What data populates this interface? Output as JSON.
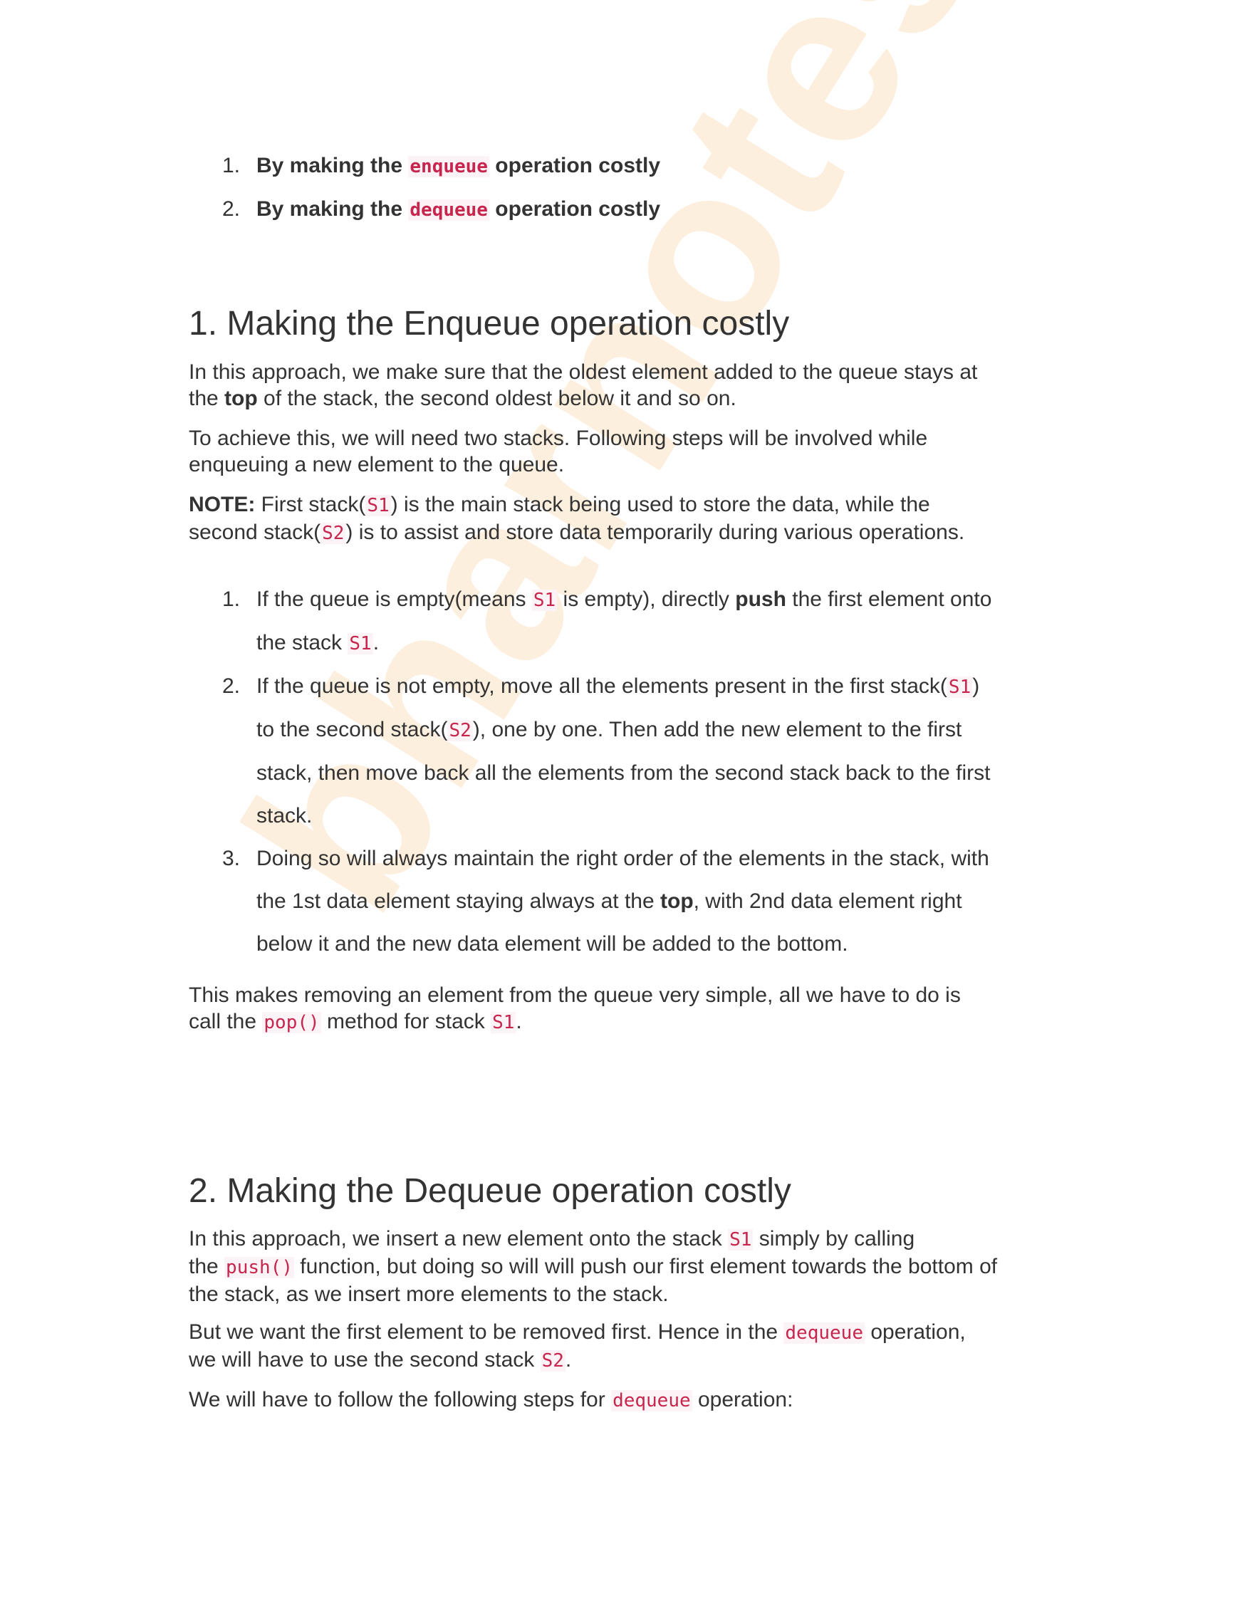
{
  "watermark": "bharnotes",
  "colors": {
    "text": "#333333",
    "code": "#c7254e",
    "watermark": "#f7a23a"
  },
  "intro_list": [
    {
      "num": "1.",
      "lines": [
        [
          {
            "t": "By making the "
          },
          {
            "t": "enqueue",
            "s": "code"
          },
          {
            "t": " operation costly"
          }
        ]
      ]
    },
    {
      "num": "2.",
      "lines": [
        [
          {
            "t": "By making the "
          },
          {
            "t": "dequeue",
            "s": "code"
          },
          {
            "t": " operation costly"
          }
        ]
      ]
    }
  ],
  "section1": {
    "heading": "1. Making the Enqueue operation costly",
    "p1": [
      [
        {
          "t": "In this approach, we make sure that the oldest element added to the queue stays at"
        }
      ],
      [
        {
          "t": "the "
        },
        {
          "t": "top",
          "s": "b"
        },
        {
          "t": " of the stack, the second oldest below it and so on."
        }
      ]
    ],
    "p2": [
      [
        {
          "t": "To achieve this, we will need two stacks. Following steps will be involved while"
        }
      ],
      [
        {
          "t": "enqueuing a new element to the queue."
        }
      ]
    ],
    "p3": [
      [
        {
          "t": "NOTE:",
          "s": "b"
        },
        {
          "t": " First stack("
        },
        {
          "t": "S1",
          "s": "code"
        },
        {
          "t": ") is the main stack being used to store the data, while the"
        }
      ],
      [
        {
          "t": "second stack("
        },
        {
          "t": "S2",
          "s": "code"
        },
        {
          "t": ") is to assist and store data temporarily during various operations."
        }
      ]
    ],
    "steps": [
      {
        "num": "1.",
        "lines": [
          [
            {
              "t": "If the queue is empty(means "
            },
            {
              "t": "S1",
              "s": "code"
            },
            {
              "t": " is empty), directly "
            },
            {
              "t": "push",
              "s": "b"
            },
            {
              "t": " the first element onto"
            }
          ],
          [
            {
              "t": "the stack "
            },
            {
              "t": "S1",
              "s": "code"
            },
            {
              "t": "."
            }
          ]
        ]
      },
      {
        "num": "2.",
        "lines": [
          [
            {
              "t": "If the queue is not empty, move all the elements present in the first stack("
            },
            {
              "t": "S1",
              "s": "code"
            },
            {
              "t": ")"
            }
          ],
          [
            {
              "t": "to the second stack("
            },
            {
              "t": "S2",
              "s": "code"
            },
            {
              "t": "), one by one. Then add the new element to the first"
            }
          ],
          [
            {
              "t": "stack, then move back all the elements from the second stack back to the first"
            }
          ],
          [
            {
              "t": "stack."
            }
          ]
        ]
      },
      {
        "num": "3.",
        "lines": [
          [
            {
              "t": "Doing so will always maintain the right order of the elements in the stack, with"
            }
          ],
          [
            {
              "t": "the 1st data element staying always at the "
            },
            {
              "t": "top",
              "s": "b"
            },
            {
              "t": ", with 2nd data element right"
            }
          ],
          [
            {
              "t": "below it and the new data element will be added to the bottom."
            }
          ]
        ]
      }
    ],
    "p4": [
      [
        {
          "t": "This makes removing an element from the queue very simple, all we have to do is"
        }
      ],
      [
        {
          "t": "call the "
        },
        {
          "t": "pop()",
          "s": "code"
        },
        {
          "t": " method for stack "
        },
        {
          "t": "S1",
          "s": "code"
        },
        {
          "t": "."
        }
      ]
    ]
  },
  "section2": {
    "heading": "2. Making the Dequeue operation costly",
    "p1": [
      [
        {
          "t": "In this approach, we insert a new element onto the stack "
        },
        {
          "t": "S1",
          "s": "code"
        },
        {
          "t": " simply by calling"
        }
      ],
      [
        {
          "t": "the "
        },
        {
          "t": "push()",
          "s": "code"
        },
        {
          "t": " function, but doing so will will push our first element towards the bottom of"
        }
      ],
      [
        {
          "t": "the stack, as we insert more elements to the stack."
        }
      ]
    ],
    "p2": [
      [
        {
          "t": "But we want the first element to be removed first. Hence in the "
        },
        {
          "t": "dequeue",
          "s": "code"
        },
        {
          "t": " operation,"
        }
      ],
      [
        {
          "t": "we will have to use the second stack "
        },
        {
          "t": "S2",
          "s": "code"
        },
        {
          "t": "."
        }
      ]
    ],
    "p3": [
      [
        {
          "t": "We will have to follow the following steps for "
        },
        {
          "t": "dequeue",
          "s": "code"
        },
        {
          "t": " operation:"
        }
      ]
    ]
  }
}
